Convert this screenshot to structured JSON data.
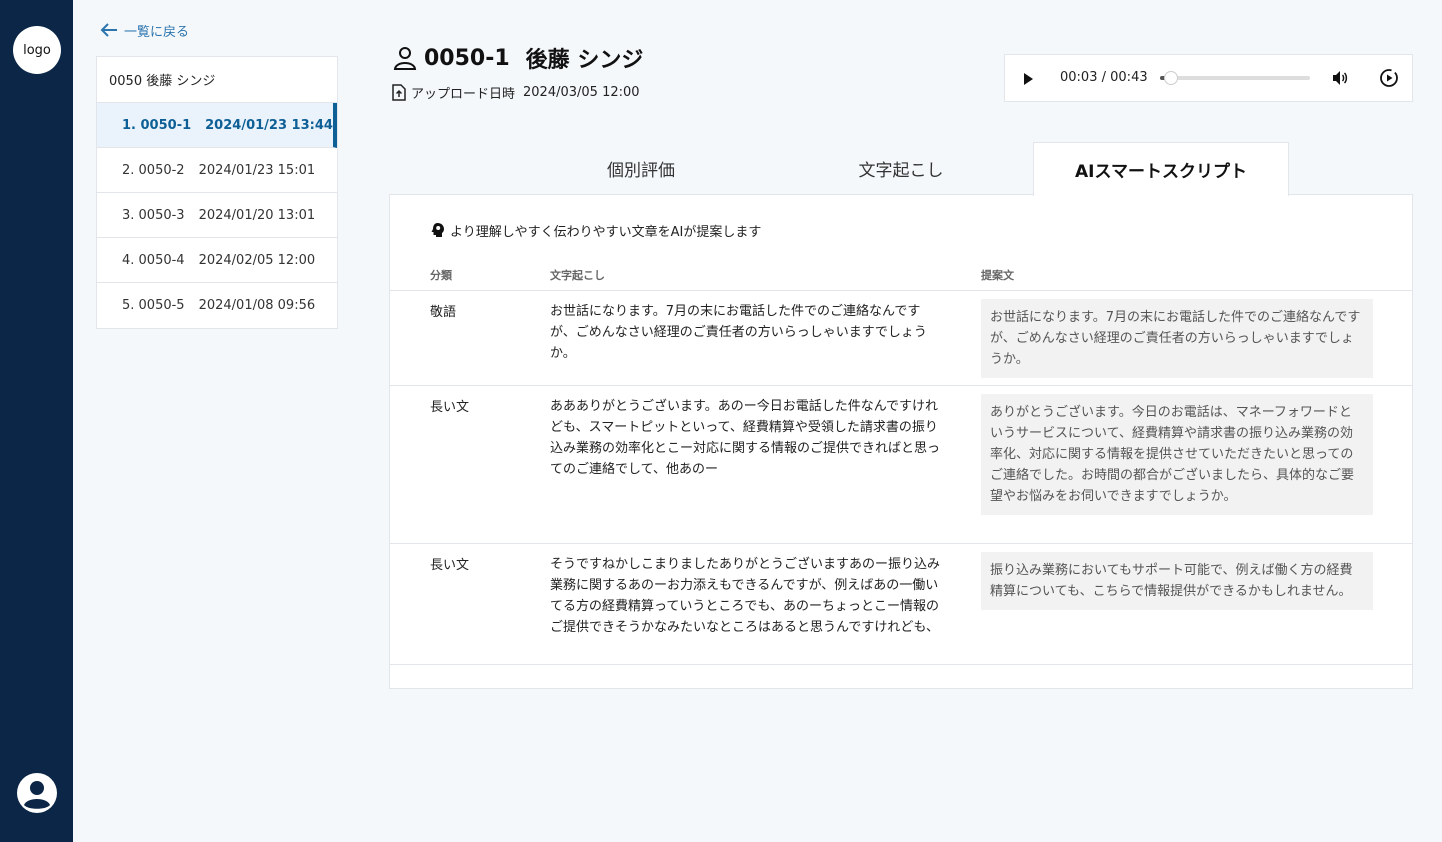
{
  "app": {
    "logo_text": "logo"
  },
  "nav": {
    "back_label": "一覧に戻る"
  },
  "list": {
    "header": "0050 後藤 シンジ",
    "items": [
      {
        "id": "1. 0050-1",
        "date": "2024/01/23 13:44",
        "active": true
      },
      {
        "id": "2. 0050-2",
        "date": "2024/01/23 15:01",
        "active": false
      },
      {
        "id": "3. 0050-3",
        "date": "2024/01/20 13:01",
        "active": false
      },
      {
        "id": "4. 0050-4",
        "date": "2024/02/05 12:00",
        "active": false
      },
      {
        "id": "5. 0050-5",
        "date": "2024/01/08 09:56",
        "active": false
      }
    ]
  },
  "record": {
    "code": "0050-1",
    "name": "後藤 シンジ",
    "upload_label": "アップロード日時",
    "upload_value": "2024/03/05 12:00"
  },
  "player": {
    "current": "00:03",
    "separator": "/",
    "duration": "00:43",
    "progress": 0.07
  },
  "tabs": [
    {
      "label": "個別評価",
      "active": false
    },
    {
      "label": "文字起こし",
      "active": false
    },
    {
      "label": "AIスマートスクリプト",
      "active": true
    }
  ],
  "smart_script": {
    "hint": "より理解しやすく伝わりやすい文章をAIが提案します",
    "columns": [
      "分類",
      "文字起こし",
      "提案文"
    ],
    "rows": [
      {
        "category": "敬語",
        "original": "お世話になります。7月の末にお電話した件でのご連絡なんですが、ごめんなさい経理のご責任者の方いらっしゃいますでしょうか。",
        "suggestion": "お世話になります。7月の末にお電話した件でのご連絡なんですが、ごめんなさい経理のご責任者の方いらっしゃいますでしょうか。"
      },
      {
        "category": "長い文",
        "original": "ああありがとうございます。あのー今日お電話した件なんですけれども、スマートピットといって、経費精算や受領した請求書の振り込み業務の効率化とこー対応に関する情報のご提供できればと思ってのご連絡でして、他あのー",
        "suggestion": "ありがとうございます。今日のお電話は、マネーフォワードというサービスについて、経費精算や請求書の振り込み業務の効率化、対応に関する情報を提供させていただきたいと思ってのご連絡でした。お時間の都合がございましたら、具体的なご要望やお悩みをお伺いできますでしょうか。"
      },
      {
        "category": "長い文",
        "original": "そうですねかしこまりましたありがとうございますあのー振り込み業務に関するあのーお力添えもできるんですが、例えばあの一働いてる方の経費精算っていうところでも、あのーちょっとこー情報のご提供できそうかなみたいなところはあると思うんですけれども、",
        "suggestion": "振り込み業務においてもサポート可能で、例えば働く方の経費精算についても、こちらで情報提供ができるかもしれません。"
      }
    ]
  }
}
